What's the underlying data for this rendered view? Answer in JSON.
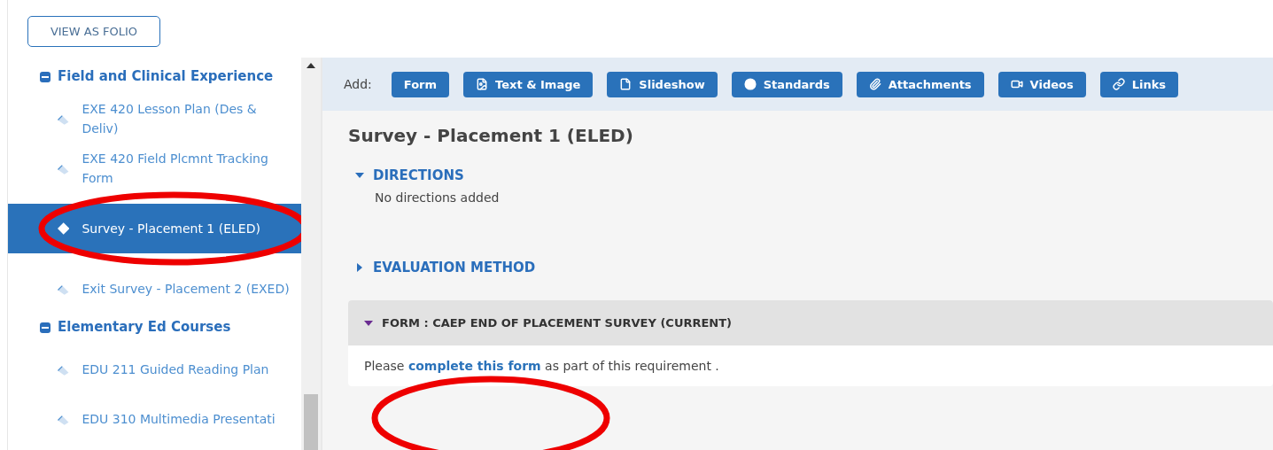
{
  "header": {
    "folio_button": "VIEW AS FOLIO"
  },
  "sidebar": {
    "groups": [
      {
        "label": "Field and Clinical Experience",
        "expanded": true,
        "children": [
          {
            "label": "EXE 420 Lesson Plan (Des & Deliv)",
            "selected": false
          },
          {
            "label": "EXE 420 Field Plcmnt Tracking Form",
            "selected": false
          },
          {
            "label": "Survey - Placement 1 (ELED)",
            "selected": true
          },
          {
            "label": "Exit Survey - Placement 2 (EXED)",
            "selected": false
          }
        ]
      },
      {
        "label": "Elementary Ed Courses",
        "expanded": true,
        "children": [
          {
            "label": "EDU 211 Guided Reading Plan",
            "selected": false
          },
          {
            "label": "EDU 310 Multimedia Presentati",
            "selected": false
          }
        ]
      }
    ]
  },
  "toolbar": {
    "label": "Add:",
    "buttons": [
      "Form",
      "Text & Image",
      "Slideshow",
      "Standards",
      "Attachments",
      "Videos",
      "Links"
    ]
  },
  "title": "Survey - Placement 1 (ELED)",
  "sections": [
    {
      "label": "DIRECTIONS",
      "expanded": true,
      "body": "No directions added"
    },
    {
      "label": "EVALUATION METHOD",
      "expanded": false
    }
  ],
  "form_panel": {
    "label": "FORM : CAEP END OF PLACEMENT SURVEY (CURRENT)",
    "expanded": true,
    "before": "Please",
    "link": "complete this form",
    "after": "as part of this requirement ."
  },
  "annotations": [
    {
      "kind": "ellipse"
    },
    {
      "kind": "ellipse"
    }
  ]
}
